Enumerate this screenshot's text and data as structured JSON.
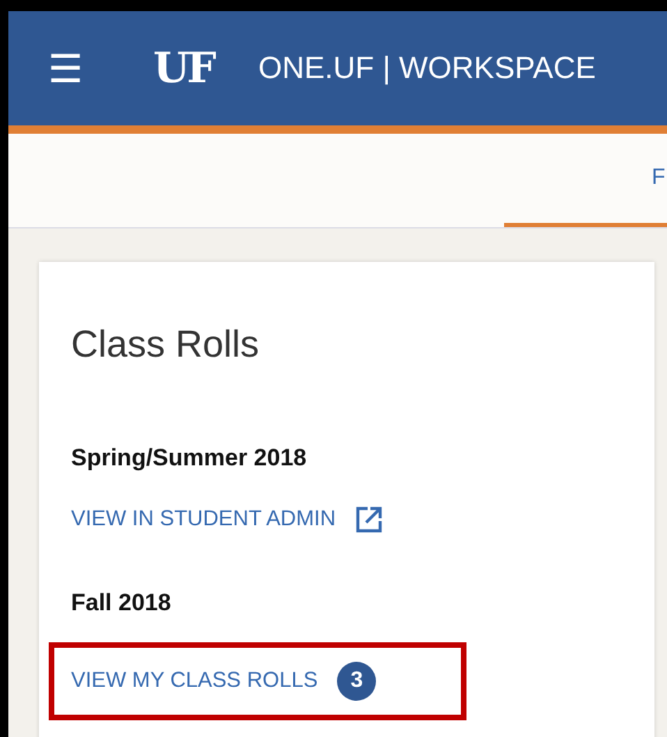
{
  "header": {
    "menu_icon": "☰",
    "logo": "UF",
    "title": "ONE.UF | WORKSPACE"
  },
  "tabs": [
    {
      "label": "F",
      "selected": true
    }
  ],
  "card": {
    "title": "Class Rolls",
    "sections": [
      {
        "term": "Spring/Summer 2018",
        "link": {
          "label": "VIEW IN STUDENT ADMIN",
          "kind": "external",
          "highlighted": false
        }
      },
      {
        "term": "Fall 2018",
        "link": {
          "label": "VIEW MY CLASS ROLLS",
          "kind": "internal",
          "count": "3",
          "highlighted": true
        }
      }
    ]
  }
}
